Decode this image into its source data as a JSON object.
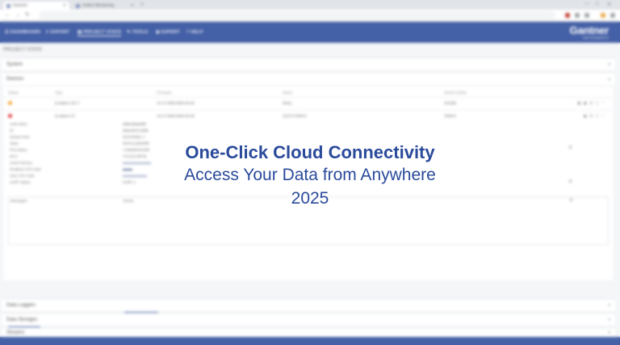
{
  "browser": {
    "tabs": [
      {
        "title": "Gantner"
      },
      {
        "title": "Online Monitoring"
      }
    ],
    "new_tab": "+",
    "address": "",
    "window_controls": [
      "—",
      "□",
      "✕"
    ],
    "nav": {
      "back": "←",
      "forward": "→",
      "reload": "↻"
    }
  },
  "nav": {
    "items": [
      {
        "icon": "☰",
        "label": "DASHBOARD"
      },
      {
        "icon": "⇩",
        "label": "EXPORT"
      },
      {
        "icon": "▣",
        "label": "PROJECT STATE"
      },
      {
        "icon": "✎",
        "label": "TOOLS"
      },
      {
        "icon": "◉",
        "label": "EXPERT"
      },
      {
        "icon": "?",
        "label": "HELP"
      }
    ],
    "brand": "Gantner",
    "brand_sub": "INSTRUMENTS"
  },
  "page": {
    "heading": "PROJECT STATE",
    "sections": {
      "system": "System",
      "devices": "Devices",
      "data_loggers": "Data Loggers",
      "data_storages": "Data Storages",
      "streams": "Streams"
    },
    "table": {
      "headers": [
        "Status",
        "Type",
        "Firmware",
        "Name",
        "Serial number"
      ],
      "rows": [
        {
          "status_color": "#f0a020",
          "type": "Q.station 101 T",
          "firmware": "V2.17.0000.0000.00.00",
          "name": "Reisy",
          "serial": "151399",
          "icons": "▣ ▣ ⚙ ⓘ ⌃"
        },
        {
          "status_color": "#e03030",
          "type": "Q.station XT",
          "firmware": "V2.17.0000.0000.00.00",
          "name": "GI1371750872",
          "serial": "750872",
          "icons": "▣ ⚙ ⓘ ⌃"
        }
      ]
    },
    "details": [
      {
        "label": "Auth token",
        "value": "dd5e2d0a6df9"
      },
      {
        "label": "ID",
        "value": "9a5e4d78-3d3b"
      },
      {
        "label": "System time",
        "value": "01/27/2025, 1"
      },
      {
        "label": "State",
        "value": "INITIALIZED/RE"
      },
      {
        "label": "Port status",
        "value": "• ONINEGOVER"
      },
      {
        "label": "MAC",
        "value": "T75.314 BFFB"
      },
      {
        "label": "Used memory",
        "value": ""
      },
      {
        "label": "Realtime CPU load",
        "value": ""
      },
      {
        "label": "User CPU load",
        "value": ""
      },
      {
        "label": "UART status",
        "value": "UART 1"
      }
    ],
    "bar_levels": [
      0.35,
      0.12,
      0.3
    ],
    "messages_label": "Messages",
    "messages_value": "Errors",
    "installed_plugins_label": "Installed plugins",
    "no_plugins": "No plugins installed",
    "install_plugin_button": "Install plugin",
    "add_device_button": "Add device"
  },
  "overlay": {
    "title": "One-Click Cloud Connectivity",
    "subtitle": "Access Your Data from Anywhere",
    "year": "2025"
  },
  "colors": {
    "brand_blue": "#2f4e9c",
    "overlay_text": "#2a4a9b"
  }
}
